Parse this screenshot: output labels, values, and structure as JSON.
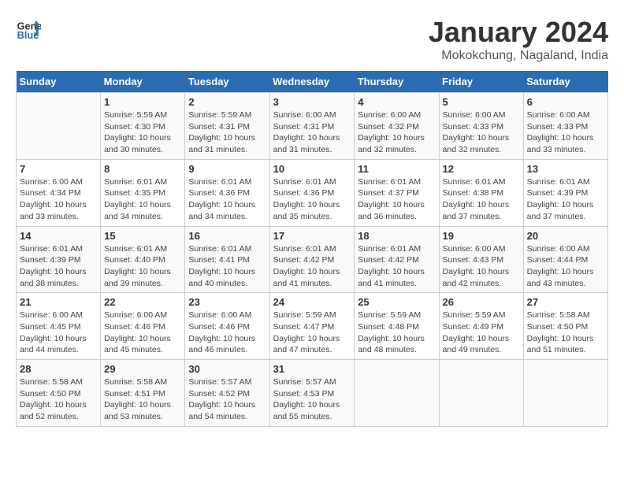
{
  "header": {
    "logo_general": "General",
    "logo_blue": "Blue",
    "title": "January 2024",
    "subtitle": "Mokokchung, Nagaland, India"
  },
  "calendar": {
    "days_of_week": [
      "Sunday",
      "Monday",
      "Tuesday",
      "Wednesday",
      "Thursday",
      "Friday",
      "Saturday"
    ],
    "weeks": [
      [
        {
          "day": "",
          "sunrise": "",
          "sunset": "",
          "daylight": ""
        },
        {
          "day": "1",
          "sunrise": "Sunrise: 5:59 AM",
          "sunset": "Sunset: 4:30 PM",
          "daylight": "Daylight: 10 hours and 30 minutes."
        },
        {
          "day": "2",
          "sunrise": "Sunrise: 5:59 AM",
          "sunset": "Sunset: 4:31 PM",
          "daylight": "Daylight: 10 hours and 31 minutes."
        },
        {
          "day": "3",
          "sunrise": "Sunrise: 6:00 AM",
          "sunset": "Sunset: 4:31 PM",
          "daylight": "Daylight: 10 hours and 31 minutes."
        },
        {
          "day": "4",
          "sunrise": "Sunrise: 6:00 AM",
          "sunset": "Sunset: 4:32 PM",
          "daylight": "Daylight: 10 hours and 32 minutes."
        },
        {
          "day": "5",
          "sunrise": "Sunrise: 6:00 AM",
          "sunset": "Sunset: 4:33 PM",
          "daylight": "Daylight: 10 hours and 32 minutes."
        },
        {
          "day": "6",
          "sunrise": "Sunrise: 6:00 AM",
          "sunset": "Sunset: 4:33 PM",
          "daylight": "Daylight: 10 hours and 33 minutes."
        }
      ],
      [
        {
          "day": "7",
          "sunrise": "Sunrise: 6:00 AM",
          "sunset": "Sunset: 4:34 PM",
          "daylight": "Daylight: 10 hours and 33 minutes."
        },
        {
          "day": "8",
          "sunrise": "Sunrise: 6:01 AM",
          "sunset": "Sunset: 4:35 PM",
          "daylight": "Daylight: 10 hours and 34 minutes."
        },
        {
          "day": "9",
          "sunrise": "Sunrise: 6:01 AM",
          "sunset": "Sunset: 4:36 PM",
          "daylight": "Daylight: 10 hours and 34 minutes."
        },
        {
          "day": "10",
          "sunrise": "Sunrise: 6:01 AM",
          "sunset": "Sunset: 4:36 PM",
          "daylight": "Daylight: 10 hours and 35 minutes."
        },
        {
          "day": "11",
          "sunrise": "Sunrise: 6:01 AM",
          "sunset": "Sunset: 4:37 PM",
          "daylight": "Daylight: 10 hours and 36 minutes."
        },
        {
          "day": "12",
          "sunrise": "Sunrise: 6:01 AM",
          "sunset": "Sunset: 4:38 PM",
          "daylight": "Daylight: 10 hours and 37 minutes."
        },
        {
          "day": "13",
          "sunrise": "Sunrise: 6:01 AM",
          "sunset": "Sunset: 4:39 PM",
          "daylight": "Daylight: 10 hours and 37 minutes."
        }
      ],
      [
        {
          "day": "14",
          "sunrise": "Sunrise: 6:01 AM",
          "sunset": "Sunset: 4:39 PM",
          "daylight": "Daylight: 10 hours and 38 minutes."
        },
        {
          "day": "15",
          "sunrise": "Sunrise: 6:01 AM",
          "sunset": "Sunset: 4:40 PM",
          "daylight": "Daylight: 10 hours and 39 minutes."
        },
        {
          "day": "16",
          "sunrise": "Sunrise: 6:01 AM",
          "sunset": "Sunset: 4:41 PM",
          "daylight": "Daylight: 10 hours and 40 minutes."
        },
        {
          "day": "17",
          "sunrise": "Sunrise: 6:01 AM",
          "sunset": "Sunset: 4:42 PM",
          "daylight": "Daylight: 10 hours and 41 minutes."
        },
        {
          "day": "18",
          "sunrise": "Sunrise: 6:01 AM",
          "sunset": "Sunset: 4:42 PM",
          "daylight": "Daylight: 10 hours and 41 minutes."
        },
        {
          "day": "19",
          "sunrise": "Sunrise: 6:00 AM",
          "sunset": "Sunset: 4:43 PM",
          "daylight": "Daylight: 10 hours and 42 minutes."
        },
        {
          "day": "20",
          "sunrise": "Sunrise: 6:00 AM",
          "sunset": "Sunset: 4:44 PM",
          "daylight": "Daylight: 10 hours and 43 minutes."
        }
      ],
      [
        {
          "day": "21",
          "sunrise": "Sunrise: 6:00 AM",
          "sunset": "Sunset: 4:45 PM",
          "daylight": "Daylight: 10 hours and 44 minutes."
        },
        {
          "day": "22",
          "sunrise": "Sunrise: 6:00 AM",
          "sunset": "Sunset: 4:46 PM",
          "daylight": "Daylight: 10 hours and 45 minutes."
        },
        {
          "day": "23",
          "sunrise": "Sunrise: 6:00 AM",
          "sunset": "Sunset: 4:46 PM",
          "daylight": "Daylight: 10 hours and 46 minutes."
        },
        {
          "day": "24",
          "sunrise": "Sunrise: 5:59 AM",
          "sunset": "Sunset: 4:47 PM",
          "daylight": "Daylight: 10 hours and 47 minutes."
        },
        {
          "day": "25",
          "sunrise": "Sunrise: 5:59 AM",
          "sunset": "Sunset: 4:48 PM",
          "daylight": "Daylight: 10 hours and 48 minutes."
        },
        {
          "day": "26",
          "sunrise": "Sunrise: 5:59 AM",
          "sunset": "Sunset: 4:49 PM",
          "daylight": "Daylight: 10 hours and 49 minutes."
        },
        {
          "day": "27",
          "sunrise": "Sunrise: 5:58 AM",
          "sunset": "Sunset: 4:50 PM",
          "daylight": "Daylight: 10 hours and 51 minutes."
        }
      ],
      [
        {
          "day": "28",
          "sunrise": "Sunrise: 5:58 AM",
          "sunset": "Sunset: 4:50 PM",
          "daylight": "Daylight: 10 hours and 52 minutes."
        },
        {
          "day": "29",
          "sunrise": "Sunrise: 5:58 AM",
          "sunset": "Sunset: 4:51 PM",
          "daylight": "Daylight: 10 hours and 53 minutes."
        },
        {
          "day": "30",
          "sunrise": "Sunrise: 5:57 AM",
          "sunset": "Sunset: 4:52 PM",
          "daylight": "Daylight: 10 hours and 54 minutes."
        },
        {
          "day": "31",
          "sunrise": "Sunrise: 5:57 AM",
          "sunset": "Sunset: 4:53 PM",
          "daylight": "Daylight: 10 hours and 55 minutes."
        },
        {
          "day": "",
          "sunrise": "",
          "sunset": "",
          "daylight": ""
        },
        {
          "day": "",
          "sunrise": "",
          "sunset": "",
          "daylight": ""
        },
        {
          "day": "",
          "sunrise": "",
          "sunset": "",
          "daylight": ""
        }
      ]
    ]
  }
}
